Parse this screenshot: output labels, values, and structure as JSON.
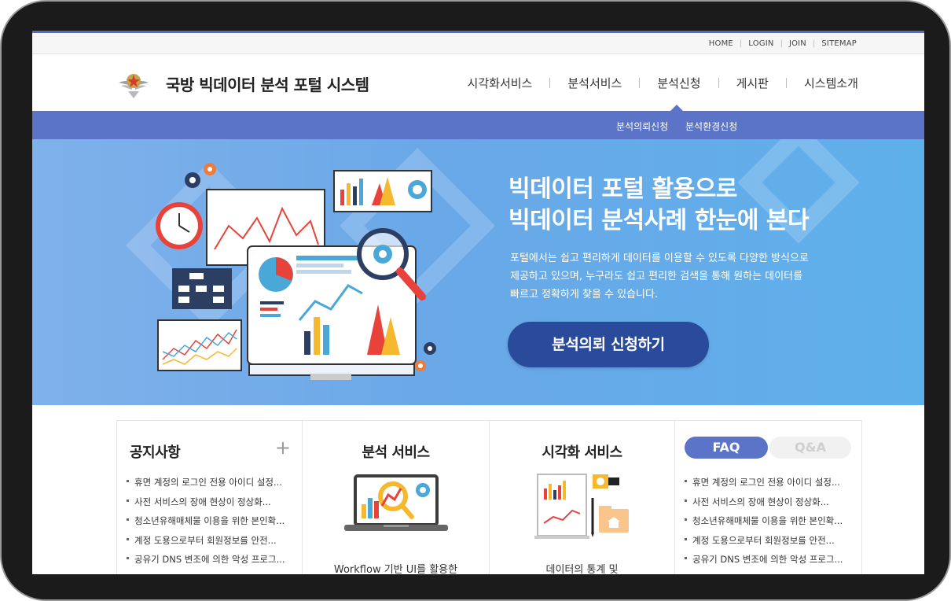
{
  "utility_links": [
    "HOME",
    "LOGIN",
    "JOIN",
    "SITEMAP"
  ],
  "site": {
    "title": "국방 빅데이터 분석 포털 시스템"
  },
  "nav": {
    "items": [
      "시각화서비스",
      "분석서비스",
      "분석신청",
      "게시판",
      "시스템소개"
    ],
    "active_index": 2
  },
  "subnav": {
    "items": [
      "분석의뢰신청",
      "분석환경신청"
    ]
  },
  "banner": {
    "headline_line1": "빅데이터 포털 활용으로",
    "headline_line2": "빅데이터 분석사례 한눈에 본다",
    "description_line1": "포털에서는 쉽고 편리하게 데이터를 이용할 수 있도록 다양한 방식으로",
    "description_line2": "제공하고 있으며, 누구라도 쉽고 편리한 검색을 통해 원하는 데이터를",
    "description_line3": "빠르고 정확하게 찾을 수 있습니다.",
    "cta_label": "분석의뢰 신청하기"
  },
  "notice": {
    "title": "공지사항",
    "more_icon": "plus-icon",
    "items": [
      "휴면 계정의 로그인 전용 아이디 설정...",
      "사전 서비스의 장애 현상이 정상화...",
      "청소년유해매체물 이용을 위한 본인확...",
      "계정 도용으로부터 회원정보를 안전...",
      "공유기 DNS 변조에 의한 악성 프로그..."
    ]
  },
  "analysis_service": {
    "title": "분석 서비스",
    "icon": "laptop-chart-icon",
    "description": "Workflow 기반 UI를 활용한"
  },
  "visual_service": {
    "title": "시각화 서비스",
    "icon": "report-folder-icon",
    "description": "데이터의 통계 및"
  },
  "faq": {
    "tab_active": "FAQ",
    "tab_inactive": "Q&A",
    "items": [
      "휴면 계정의 로그인 전용 아이디 설정...",
      "사전 서비스의 장애 현상이 정상화...",
      "청소년유해매체물 이용을 위한 본인확...",
      "계정 도용으로부터 회원정보를 안전...",
      "공유기 DNS 변조에 의한 악성 프로그..."
    ]
  },
  "colors": {
    "accent": "#5c74c8",
    "cta": "#2a4a9b",
    "banner": "#6aa8e8"
  }
}
